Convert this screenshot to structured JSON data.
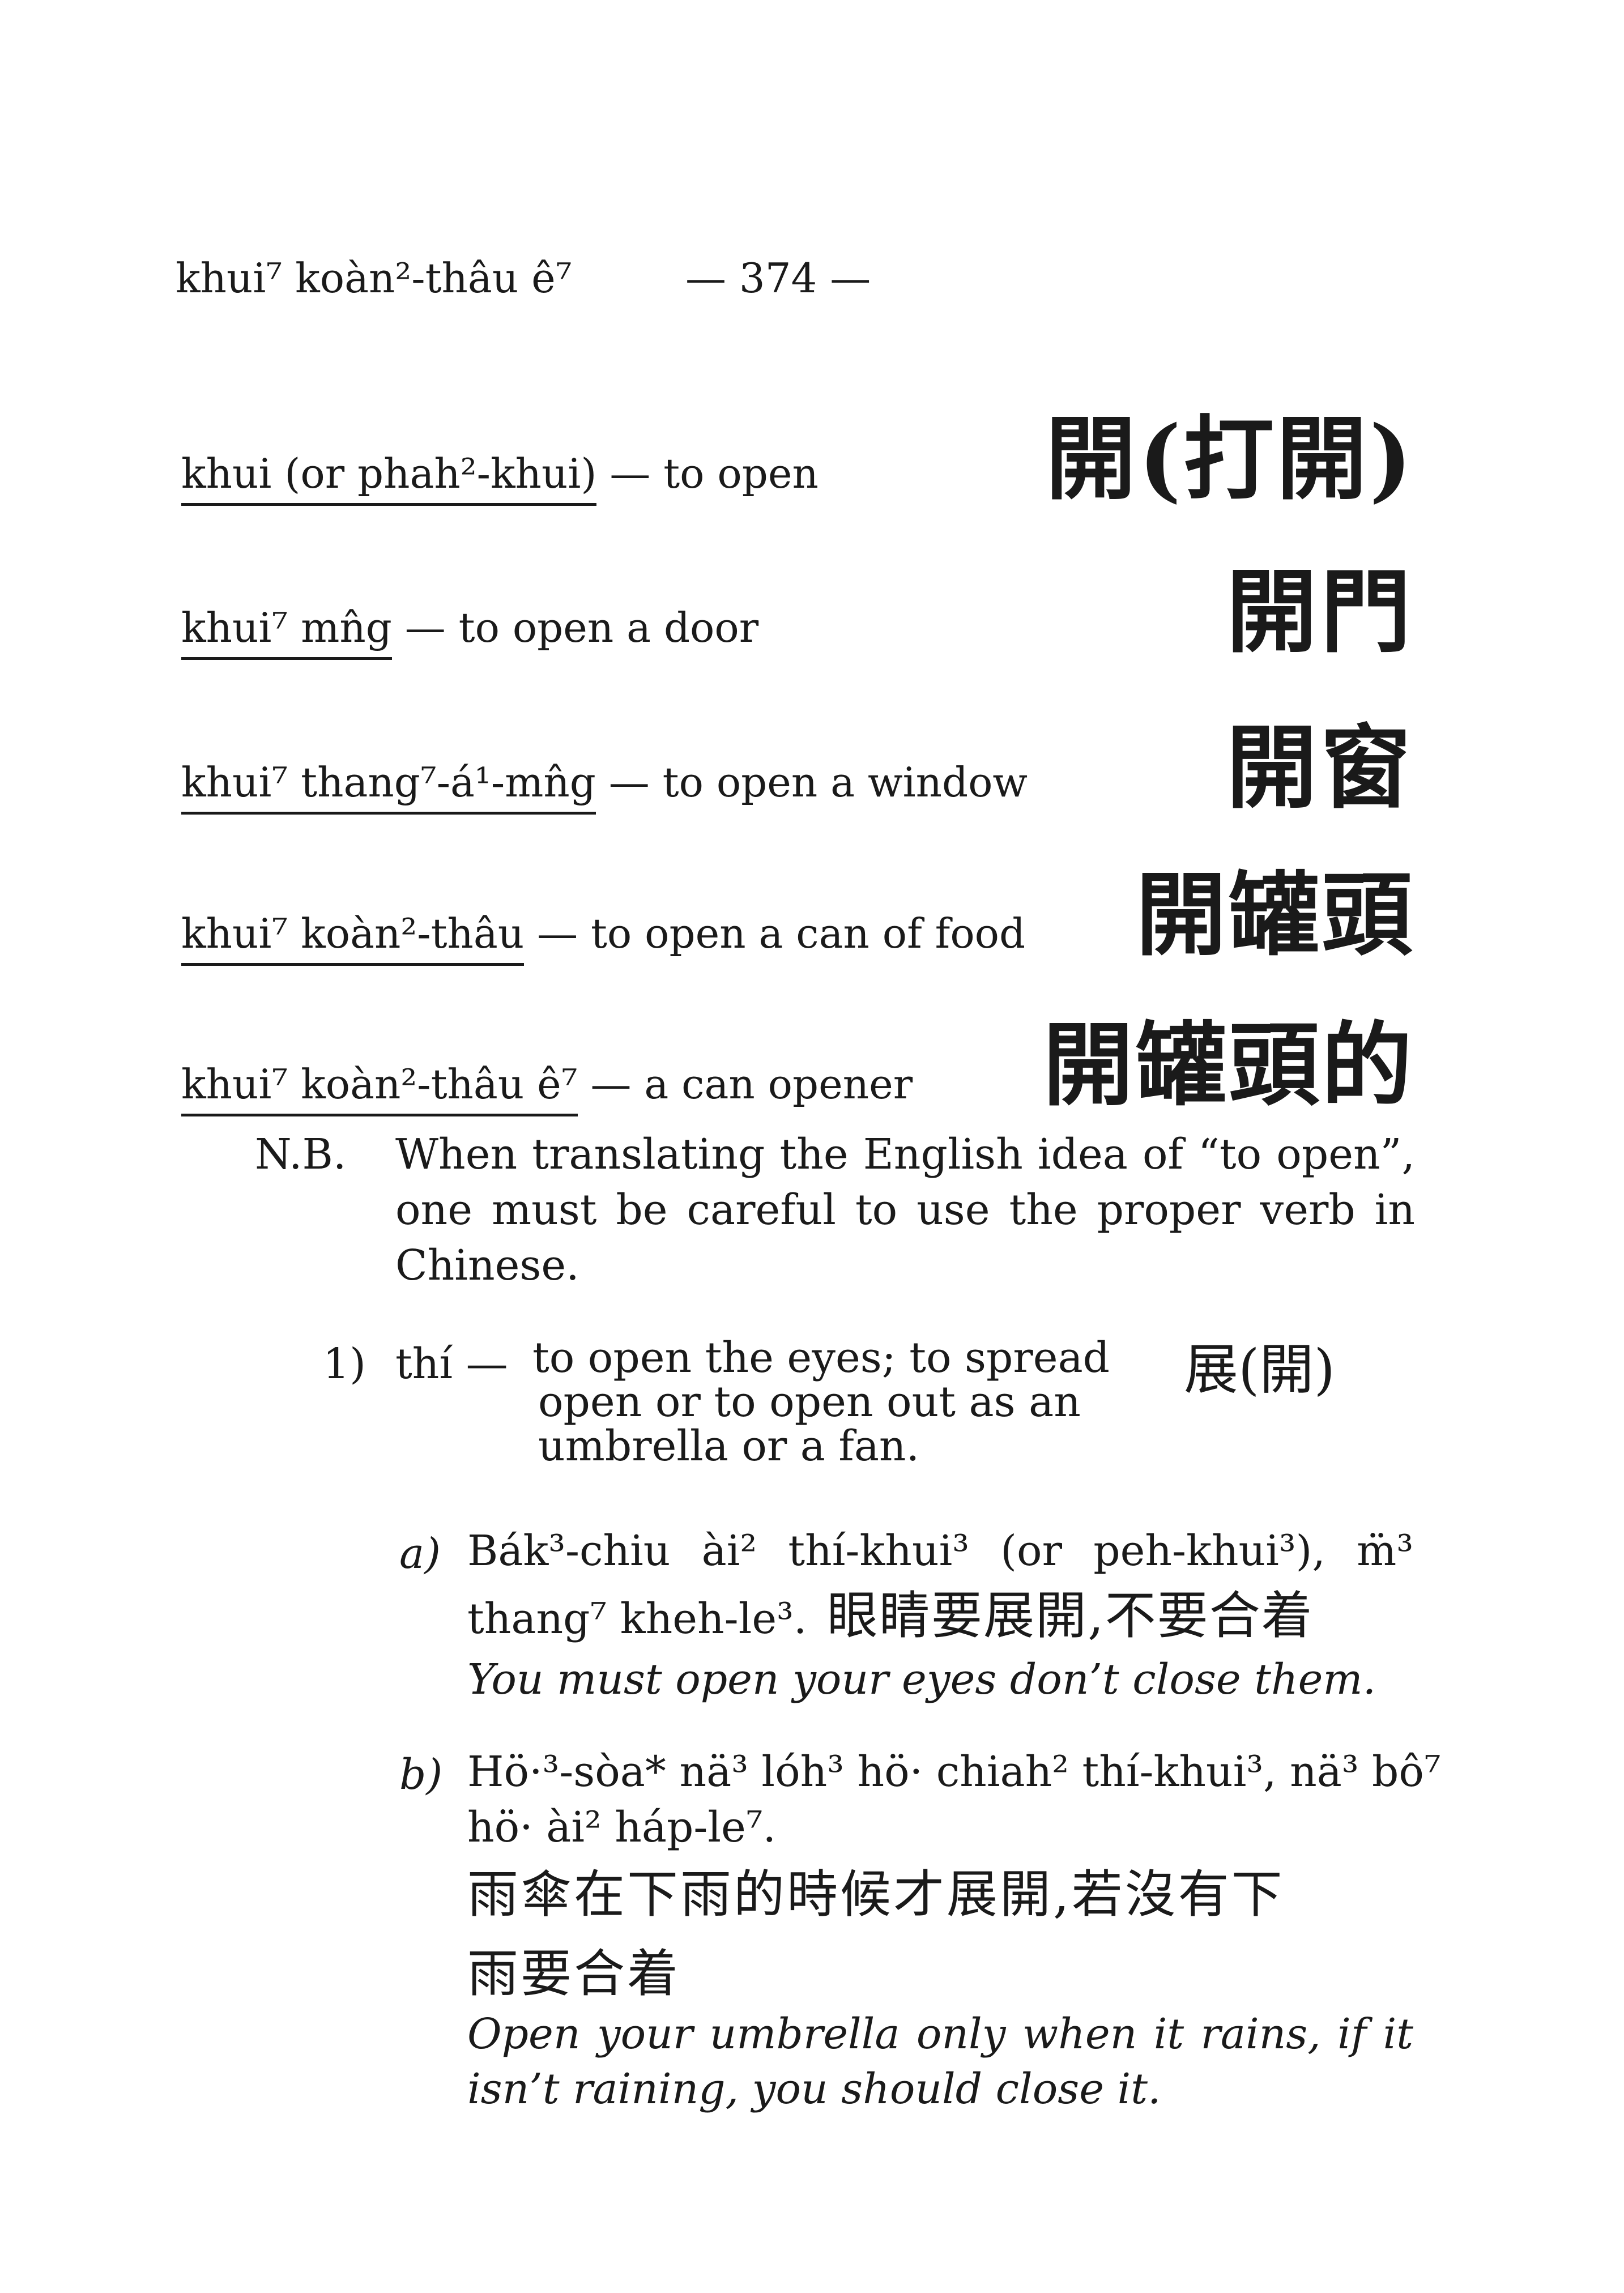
{
  "header": {
    "running_head": "khui⁷ koàn²-thâu ê⁷",
    "page_number": "— 374 —"
  },
  "entries": [
    {
      "term": "khui (or phah²-khui)",
      "gloss": "— to open",
      "hanzi": "開(打開)"
    },
    {
      "term": "khui⁷ mn̂g",
      "gloss": "— to open a door",
      "hanzi": "開門"
    },
    {
      "term": "khui⁷ thang⁷-á¹-mn̂g",
      "gloss": "— to open a window",
      "hanzi": "開窗"
    },
    {
      "term": "khui⁷ koàn²-thâu",
      "gloss": "— to open a can of food",
      "hanzi": "開罐頭"
    },
    {
      "term": "khui⁷ koàn²-thâu ê⁷",
      "gloss": "— a can opener",
      "hanzi": "開罐頭的"
    }
  ],
  "note": {
    "label": "N.B.",
    "lines": [
      "When translating the English idea of “to open”,",
      "one must be careful to use the proper verb in",
      "Chinese."
    ]
  },
  "sub1": {
    "num": "1)",
    "head": "thí —",
    "lines": [
      "to open the eyes; to spread",
      "open or to open out as an",
      "umbrella or a fan."
    ],
    "hanzi": "展(開)"
  },
  "example_a": {
    "label": "a)",
    "line1": "Bák³-chiu ài² thí-khui³ (or peh-khui³), m̈³",
    "line2": "thang⁷ kheh-le³.",
    "chinese": "眼睛要展開,不要合着",
    "translation": "You must open your eyes don’t close them."
  },
  "example_b": {
    "label": "b)",
    "line1": "Hö·³-sòa* nä³ lóh³ hö· chiah² thí-khui³, nä³ bô⁷",
    "line2": "hö· ài² háp-le⁷.",
    "chinese_line1": "雨傘在下雨的時候才展開,若沒有下",
    "chinese_line2": "雨要合着",
    "translation_line1": "Open your umbrella only when it rains, if it",
    "translation_line2": "isn’t raining, you should close it."
  }
}
